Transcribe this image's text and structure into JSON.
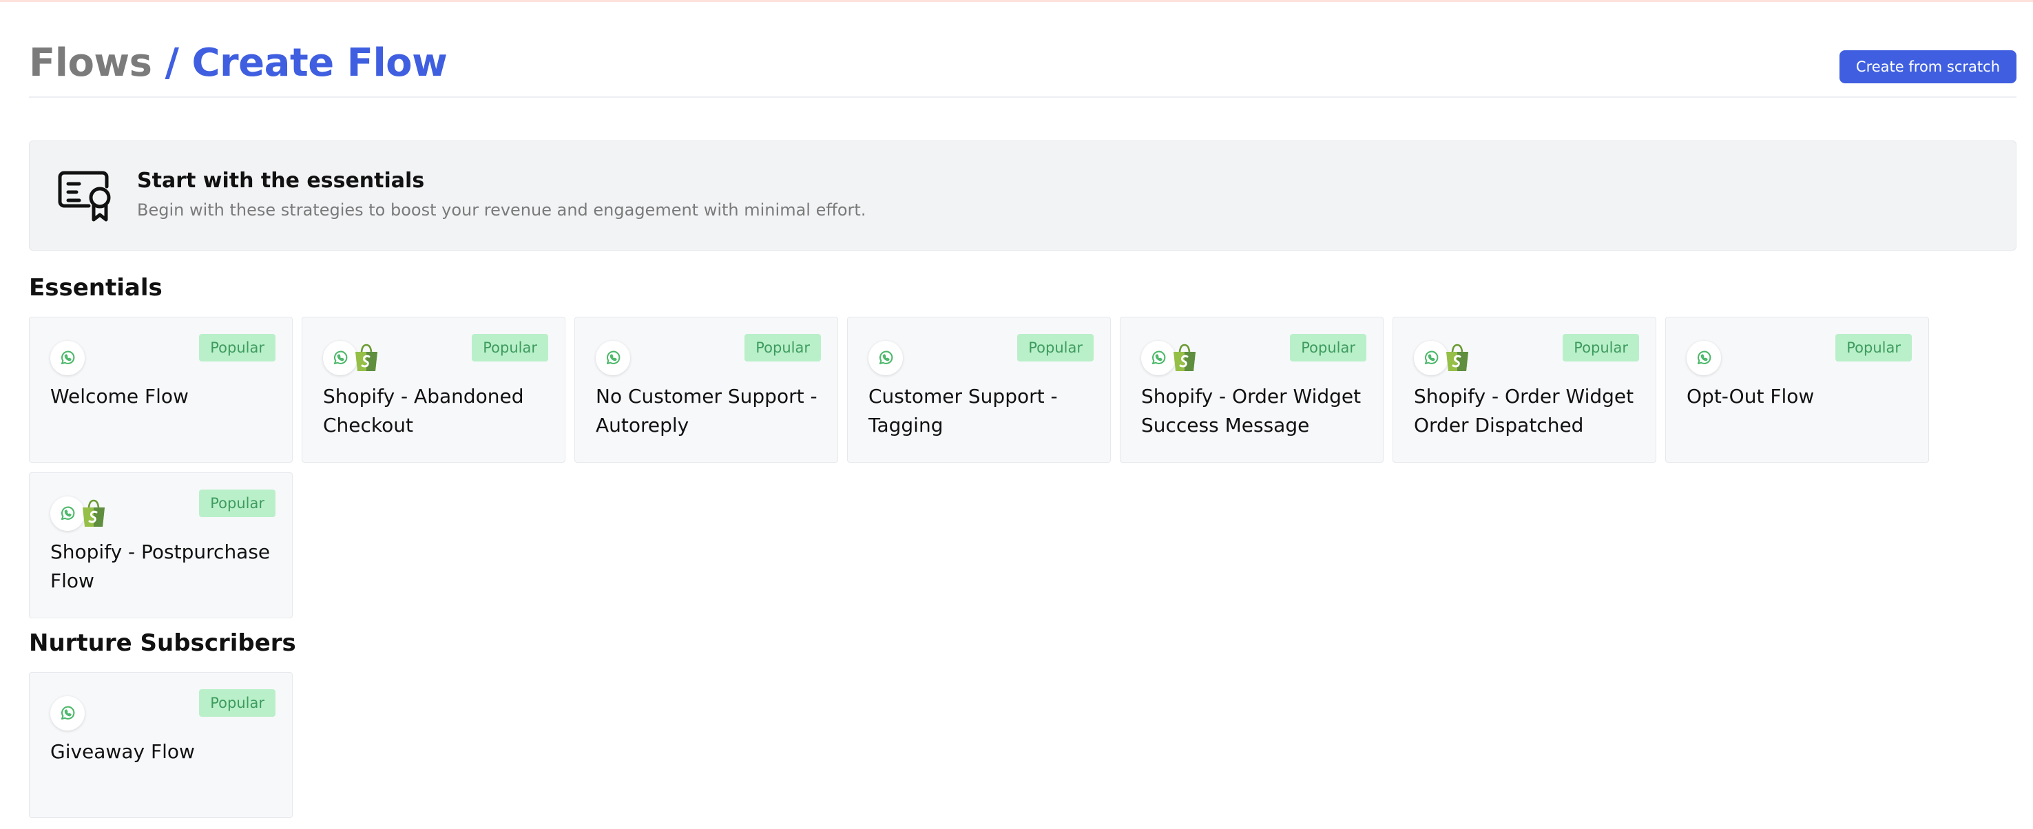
{
  "header": {
    "breadcrumb_parent": "Flows",
    "breadcrumb_separator": "/",
    "breadcrumb_current": "Create Flow",
    "create_button_label": "Create from scratch"
  },
  "banner": {
    "icon": "certificate-icon",
    "title": "Start with the essentials",
    "subtitle": "Begin with these strategies to boost your revenue and engagement with minimal effort."
  },
  "sections": {
    "essentials": {
      "title": "Essentials",
      "cards": [
        {
          "title": "Welcome Flow",
          "badge": "Popular",
          "icons": [
            "whatsapp-icon"
          ]
        },
        {
          "title": "Shopify - Abandoned Checkout",
          "badge": "Popular",
          "icons": [
            "whatsapp-icon",
            "shopify-icon"
          ]
        },
        {
          "title": "No Customer Support - Autoreply",
          "badge": "Popular",
          "icons": [
            "whatsapp-icon"
          ]
        },
        {
          "title": "Customer Support - Tagging",
          "badge": "Popular",
          "icons": [
            "whatsapp-icon"
          ]
        },
        {
          "title": "Shopify - Order Widget Success Message",
          "badge": "Popular",
          "icons": [
            "whatsapp-icon",
            "shopify-icon"
          ]
        },
        {
          "title": "Shopify - Order Widget Order Dispatched",
          "badge": "Popular",
          "icons": [
            "whatsapp-icon",
            "shopify-icon"
          ]
        },
        {
          "title": "Opt-Out Flow",
          "badge": "Popular",
          "icons": [
            "whatsapp-icon"
          ]
        },
        {
          "title": "Shopify - Postpurchase Flow",
          "badge": "Popular",
          "icons": [
            "whatsapp-icon",
            "shopify-icon"
          ]
        }
      ]
    },
    "nurture": {
      "title": "Nurture Subscribers",
      "cards": [
        {
          "title": "Giveaway Flow",
          "badge": "Popular",
          "icons": [
            "whatsapp-icon"
          ]
        }
      ]
    }
  },
  "colors": {
    "accent": "#3f5fe0",
    "badge_bg": "#b9f0c9",
    "badge_text": "#3e9b5e",
    "whatsapp": "#4cb86a",
    "shopify": "#95bf47"
  }
}
